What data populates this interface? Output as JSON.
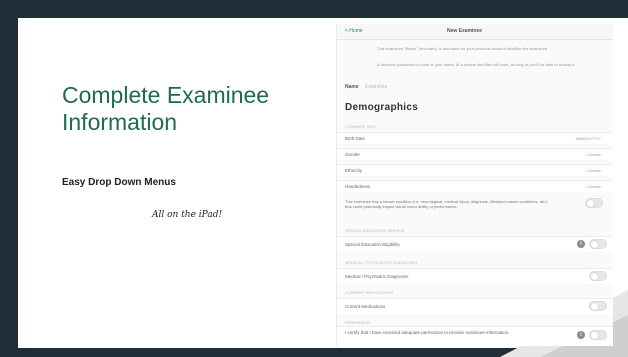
{
  "slide": {
    "title": "Complete Examinee Information",
    "subtitle": "Easy Drop Down Menus",
    "tagline": "All on the iPad!"
  },
  "ipad": {
    "nav_back": "< Home",
    "nav_title": "New Examinee",
    "note1": "This examinee \"Name\" (encoded), a nickname for your personal account identifier the examinee.",
    "note2": "A detected password is found at your name. At a unique identifier will work, as long as you'll be able to access it.",
    "name_label": "Name",
    "name_placeholder": "Examinee",
    "demographics_title": "Demographics",
    "demographics_header": "EXAMINEE INFO",
    "rows": [
      {
        "label": "Birth Date",
        "value": "MM/DD/YYYY"
      },
      {
        "label": "Gender",
        "value": "Choose"
      },
      {
        "label": "Ethnicity",
        "value": "Choose"
      },
      {
        "label": "Handedness",
        "value": "Choose"
      }
    ],
    "paragraph": "This examinee has a known condition (i.e. neurological, medical injury, diagnosis, lifestyle/consent conditions, etc.) that could potentially impact visual motor ability or performance.",
    "special_header": "SPECIAL EDUCATION SERVICE",
    "special_label": "Special Education Eligibility",
    "medical_header": "MEDICAL / PSYCHIATRIC DIAGNOSES",
    "medical_label": "Medical / Psychiatric Diagnoses",
    "medication_header": "CURRENT MEDICATIONS",
    "medication_label": "Current Medications",
    "consent_header": "PERMISSION",
    "consent_label": "I certify that I have received adequate permission to provide examinee information."
  }
}
